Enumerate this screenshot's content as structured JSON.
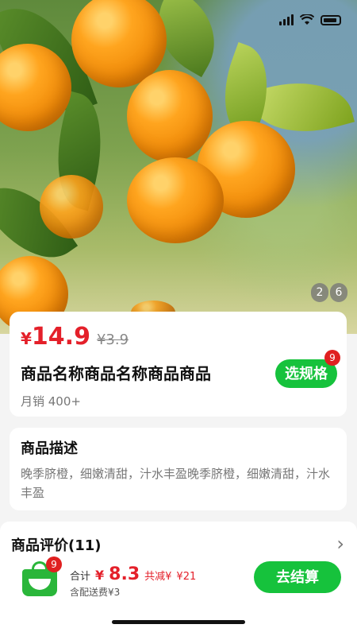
{
  "status": {
    "time": ""
  },
  "hero": {
    "pager_current": "2",
    "pager_total": "6"
  },
  "product": {
    "price_symbol": "¥",
    "price": "14.9",
    "original_price": "¥3.9",
    "name": "商品名称商品名称商品商品",
    "sales": "月销  400+",
    "spec_button": "选规格",
    "spec_badge": "9"
  },
  "description": {
    "title": "商品描述",
    "text": "晚季脐橙，细嫩清甜，汁水丰盈晚季脐橙，细嫩清甜，汁水丰盈"
  },
  "reviews": {
    "title": "商品评价(11)"
  },
  "bottom_bar": {
    "cart_badge": "9",
    "total_label": "合计",
    "total_symbol": "¥",
    "total_amount": "8.3",
    "reduction_label": "共减¥",
    "reduction_amount": "¥21",
    "shipping": "含配送费¥3",
    "checkout_button": "去结算"
  },
  "colors": {
    "accent": "#16c23c",
    "price": "#e4202a"
  }
}
